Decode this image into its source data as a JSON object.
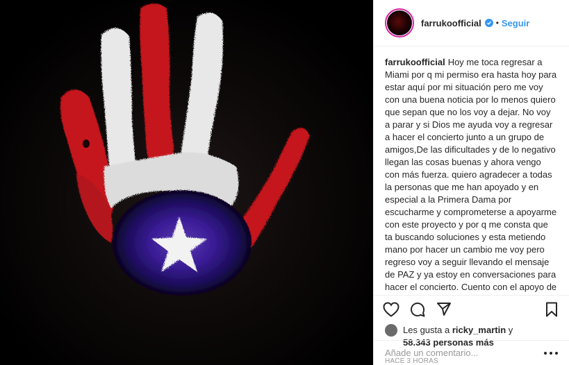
{
  "header": {
    "username": "farrukoofficial",
    "separator": "•",
    "follow_label": "Seguir"
  },
  "caption": {
    "username": "farrukoofficial",
    "text": "Hoy me toca regresar a Miami por q mi permiso era hasta hoy para estar aquí por mi situación pero me voy con una buena noticia por lo menos quiero que sepan que no los voy a dejar. No voy a parar y si Dios me ayuda voy a regresar a hacer el concierto junto a un grupo de amigos,De las dificultades y de lo negativo llegan las cosas buenas y ahora vengo con más fuerza. quiero agradecer a todas la personas que me han apoyado y en especial a la Primera Dama por escucharme y comprometerse a apoyarme con este proyecto y por q me consta que ta buscando soluciones y esta metiendo mano por hacer un cambio me voy pero regreso voy a seguir llevando el mensaje de PAZ y ya estoy en conversaciones para hacer el concierto. Cuento con el apoyo de todos en especial el de mis amigos artistas"
  },
  "likes": {
    "prefix": "Les gusta a",
    "user": "ricky_martin",
    "conjunction": "y",
    "count": "58.343 personas más"
  },
  "timestamp": "HACE 3 HORAS",
  "comment": {
    "placeholder": "Añade un comentario..."
  },
  "icons": {
    "like": "heart-icon",
    "comment": "speech-bubble-icon",
    "share": "paper-plane-icon",
    "save": "bookmark-icon",
    "options": "more-options-icon"
  },
  "colors": {
    "accent": "#3897f0",
    "text": "#262626",
    "muted": "#999999",
    "border": "#efefef"
  }
}
